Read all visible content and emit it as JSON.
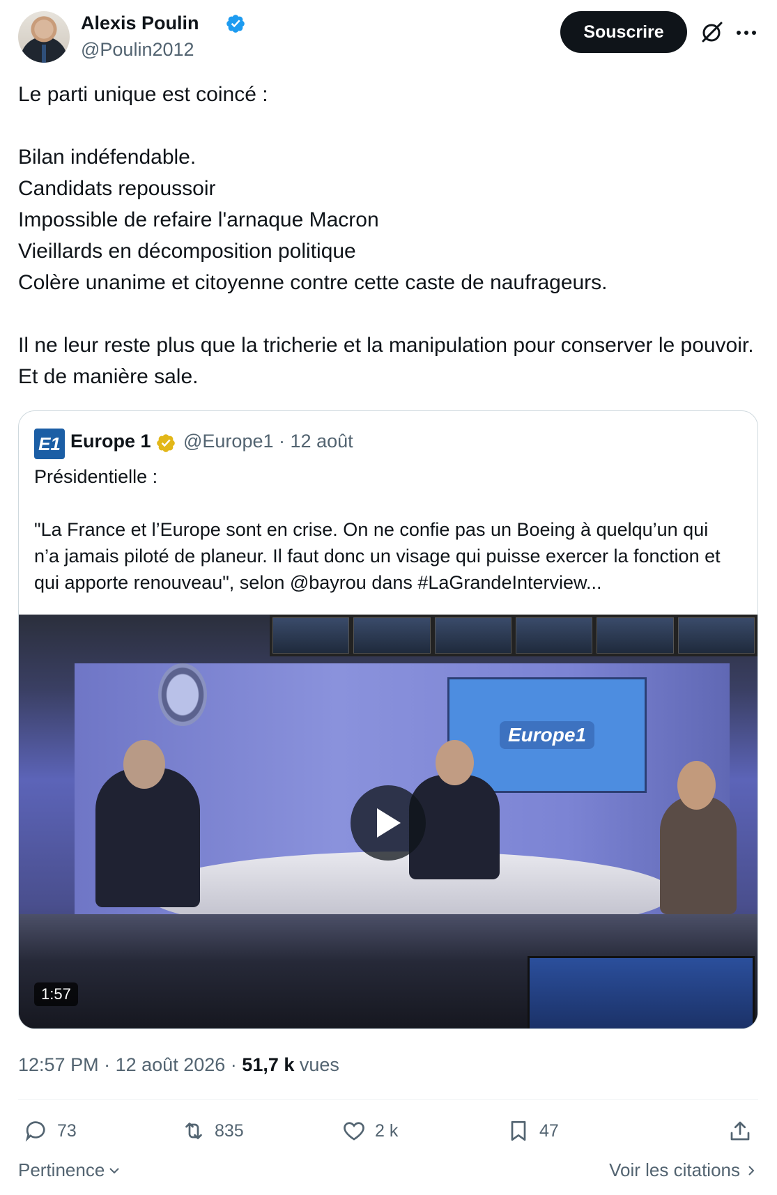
{
  "author": {
    "name": "Alexis Poulin",
    "handle": "@Poulin2012"
  },
  "header": {
    "subscribe_label": "Souscrire"
  },
  "tweet": {
    "lines": [
      "Le parti unique est coincé :",
      "Bilan indéfendable.",
      "Candidats repoussoir",
      "Impossible de refaire l'arnaque Macron",
      "Vieillards en décomposition politique",
      "Colère unanime et citoyenne contre cette caste de naufrageurs.",
      "Il ne leur reste plus que la tricherie et la manipulation pour conserver le pouvoir. Et de manière sale."
    ]
  },
  "quote": {
    "logo_text": "E1",
    "name": "Europe 1",
    "handle": "@Europe1",
    "separator": "·",
    "date": "12 août",
    "line1": "Présidentielle :",
    "line2": "\"La France et l’Europe sont en crise. On ne confie pas un Boeing à quelqu’un qui n’a jamais piloté de planeur. Il faut donc un visage qui puisse exercer la fonction et qui apporte renouveau\", selon @bayrou dans #LaGrandeInterview...",
    "video": {
      "duration": "1:57",
      "screen_brand": "Europe1"
    }
  },
  "meta": {
    "time": "12:57 PM",
    "separator": "·",
    "date": "12 août 2026",
    "views_count": "51,7 k",
    "views_label": "vues"
  },
  "actions": {
    "replies": "73",
    "reposts": "835",
    "likes": "2 k",
    "bookmarks": "47"
  },
  "footer": {
    "sort_label": "Pertinence",
    "quotes_label": "Voir les citations"
  },
  "colors": {
    "text": "#0f1419",
    "secondary": "#536471",
    "verified_blue": "#1d9bf0",
    "verified_gold": "#e2b719",
    "border": "#cfd9de"
  }
}
